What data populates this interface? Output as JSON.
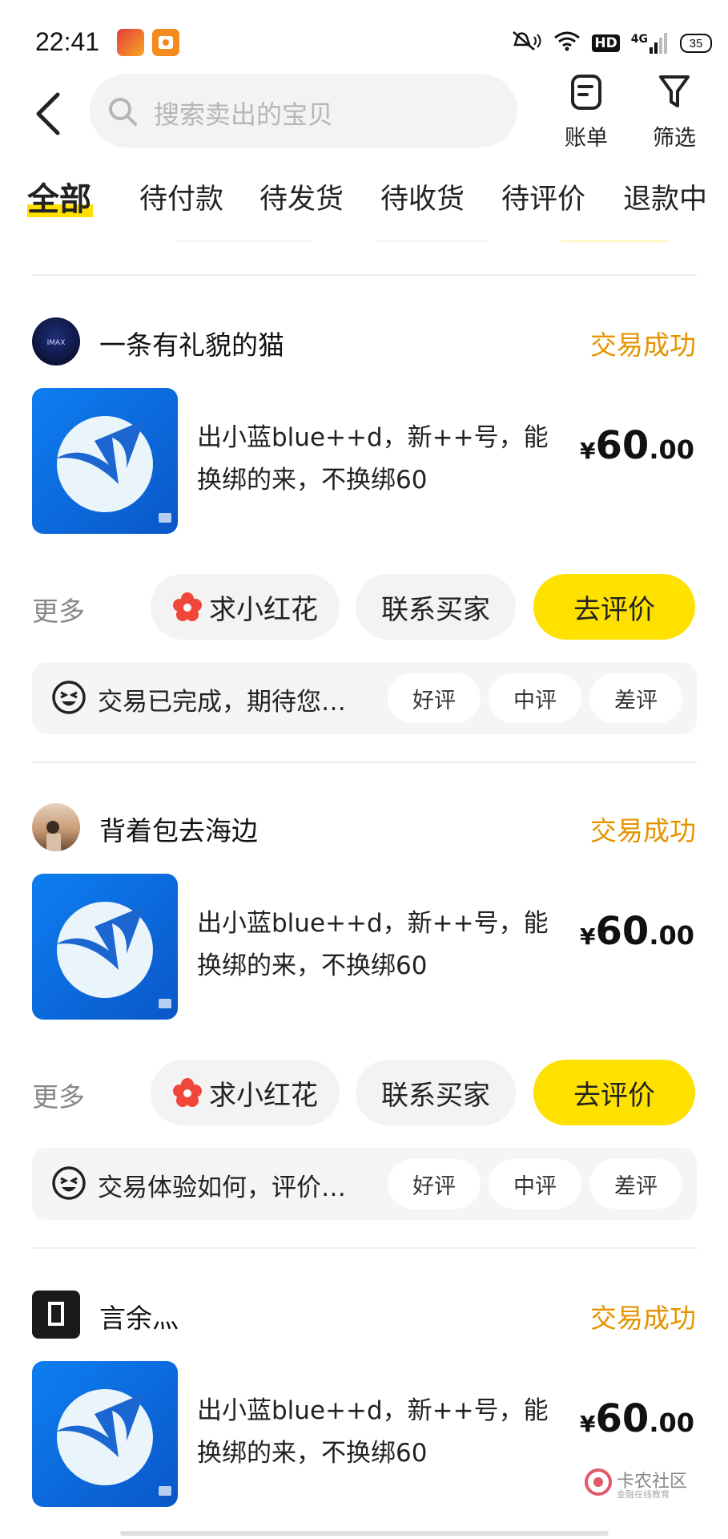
{
  "status_bar": {
    "time": "22:41",
    "hd": "HD",
    "network": "4G",
    "battery": "35"
  },
  "header": {
    "search_placeholder": "搜索卖出的宝贝",
    "bill_label": "账单",
    "filter_label": "筛选"
  },
  "tabs": [
    {
      "label": "全部",
      "active": true
    },
    {
      "label": "待付款"
    },
    {
      "label": "待发货"
    },
    {
      "label": "待收货"
    },
    {
      "label": "待评价"
    },
    {
      "label": "退款中"
    }
  ],
  "orders": [
    {
      "buyer": "一条有礼貌的猫",
      "status": "交易成功",
      "title": "出小蓝blue++d，新++号，能换绑的来，不换绑60",
      "price_symbol": "¥",
      "price_int": "60",
      "price_dec": ".00",
      "more": "更多",
      "btn_flower": "求小红花",
      "btn_contact": "联系买家",
      "btn_review": "去评价",
      "review_prompt": "交易已完成，期待您…",
      "rate_good": "好评",
      "rate_mid": "中评",
      "rate_bad": "差评"
    },
    {
      "buyer": "背着包去海边",
      "status": "交易成功",
      "title": "出小蓝blue++d，新++号，能换绑的来，不换绑60",
      "price_symbol": "¥",
      "price_int": "60",
      "price_dec": ".00",
      "more": "更多",
      "btn_flower": "求小红花",
      "btn_contact": "联系买家",
      "btn_review": "去评价",
      "review_prompt": "交易体验如何，评价…",
      "rate_good": "好评",
      "rate_mid": "中评",
      "rate_bad": "差评"
    },
    {
      "buyer": "言余灬",
      "status": "交易成功",
      "title": "出小蓝blue++d，新++号，能换绑的来，不换绑60",
      "price_symbol": "¥",
      "price_int": "60",
      "price_dec": ".00"
    }
  ],
  "watermark": {
    "line1": "卡农社区",
    "line2": "金融在线教育"
  },
  "colors": {
    "accent_yellow": "#ffe100",
    "status_orange": "#e59400"
  }
}
